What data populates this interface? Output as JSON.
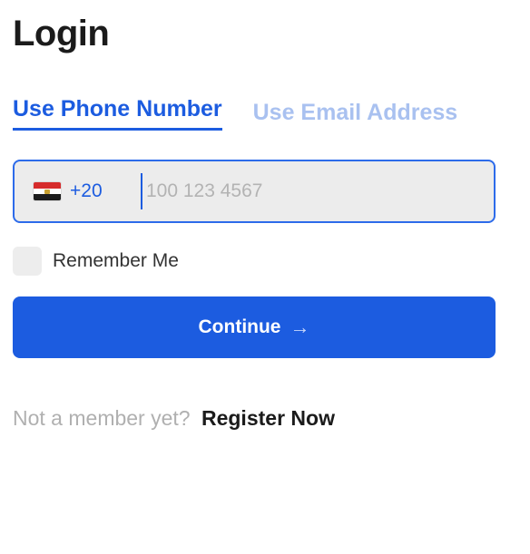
{
  "page": {
    "title": "Login"
  },
  "tabs": [
    {
      "label": "Use Phone Number",
      "active": true
    },
    {
      "label": "Use Email Address",
      "active": false
    }
  ],
  "phone": {
    "country_flag": "egypt-flag-icon",
    "dial_code": "+20",
    "value": "",
    "placeholder": "100 123 4567"
  },
  "remember": {
    "label": "Remember Me",
    "checked": false
  },
  "continue": {
    "label": "Continue",
    "icon": "arrow-right-icon"
  },
  "signup": {
    "prompt": "Not a member yet?",
    "link_label": "Register Now"
  },
  "colors": {
    "primary": "#1c5ce0",
    "tab_inactive": "#a9c1f0",
    "field_background": "#ececec",
    "muted_text": "#b0b0b0"
  }
}
